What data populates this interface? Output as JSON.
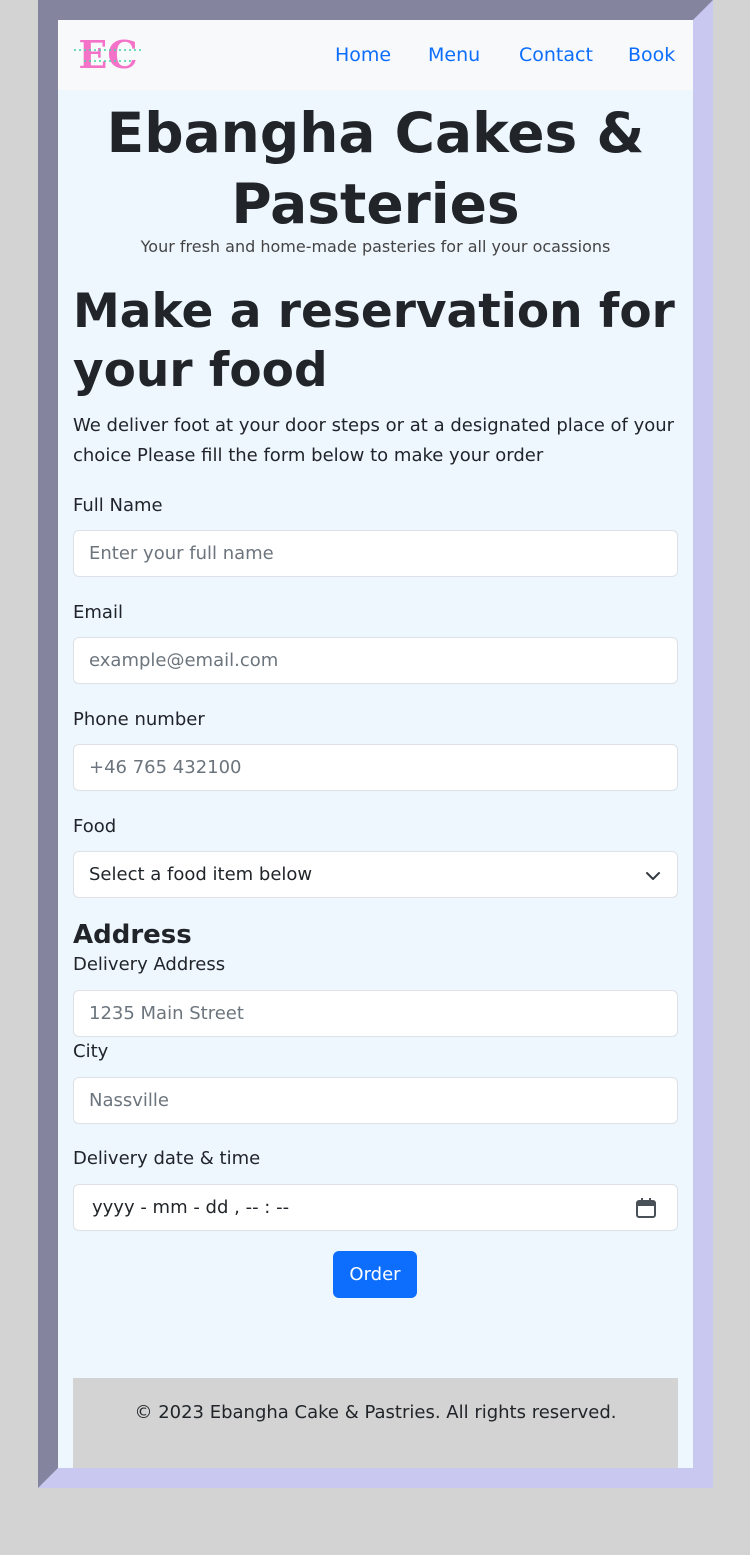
{
  "brand": {
    "logo_text": "EC"
  },
  "nav": {
    "items": [
      "Home",
      "Menu",
      "Contact",
      "Book"
    ]
  },
  "hero": {
    "title": "Ebangha Cakes & Pasteries",
    "tagline": "Your fresh and home-made pasteries for all your ocassions"
  },
  "reservation": {
    "heading": "Make a reservation for your food",
    "intro": "We deliver foot at your door steps or at a designated place of your choice Please fill the form below to make your order"
  },
  "form": {
    "full_name": {
      "label": "Full Name",
      "placeholder": "Enter your full name"
    },
    "email": {
      "label": "Email",
      "placeholder": "example@email.com"
    },
    "phone": {
      "label": "Phone number",
      "placeholder": "+46 765 432100"
    },
    "food": {
      "label": "Food",
      "selected": "Select a food item below"
    },
    "address_section": "Address",
    "delivery_address": {
      "label": "Delivery Address",
      "placeholder": "1235 Main Street"
    },
    "city": {
      "label": "City",
      "placeholder": "Nassville"
    },
    "datetime": {
      "label": "Delivery date & time",
      "placeholder": "yyyy - mm - dd ,  -- : --"
    },
    "submit_label": "Order"
  },
  "footer": {
    "text": "© 2023 Ebangha Cake & Pastries. All rights reserved."
  },
  "colors": {
    "accent": "#0d6efd",
    "logo_pink": "#f472c8",
    "logo_green": "#3fd6a0",
    "page_bg": "#eef6fe",
    "footer_bg": "#d3d3d3"
  },
  "icons": {
    "select": "chevron-down-icon",
    "datetime": "calendar-icon"
  }
}
